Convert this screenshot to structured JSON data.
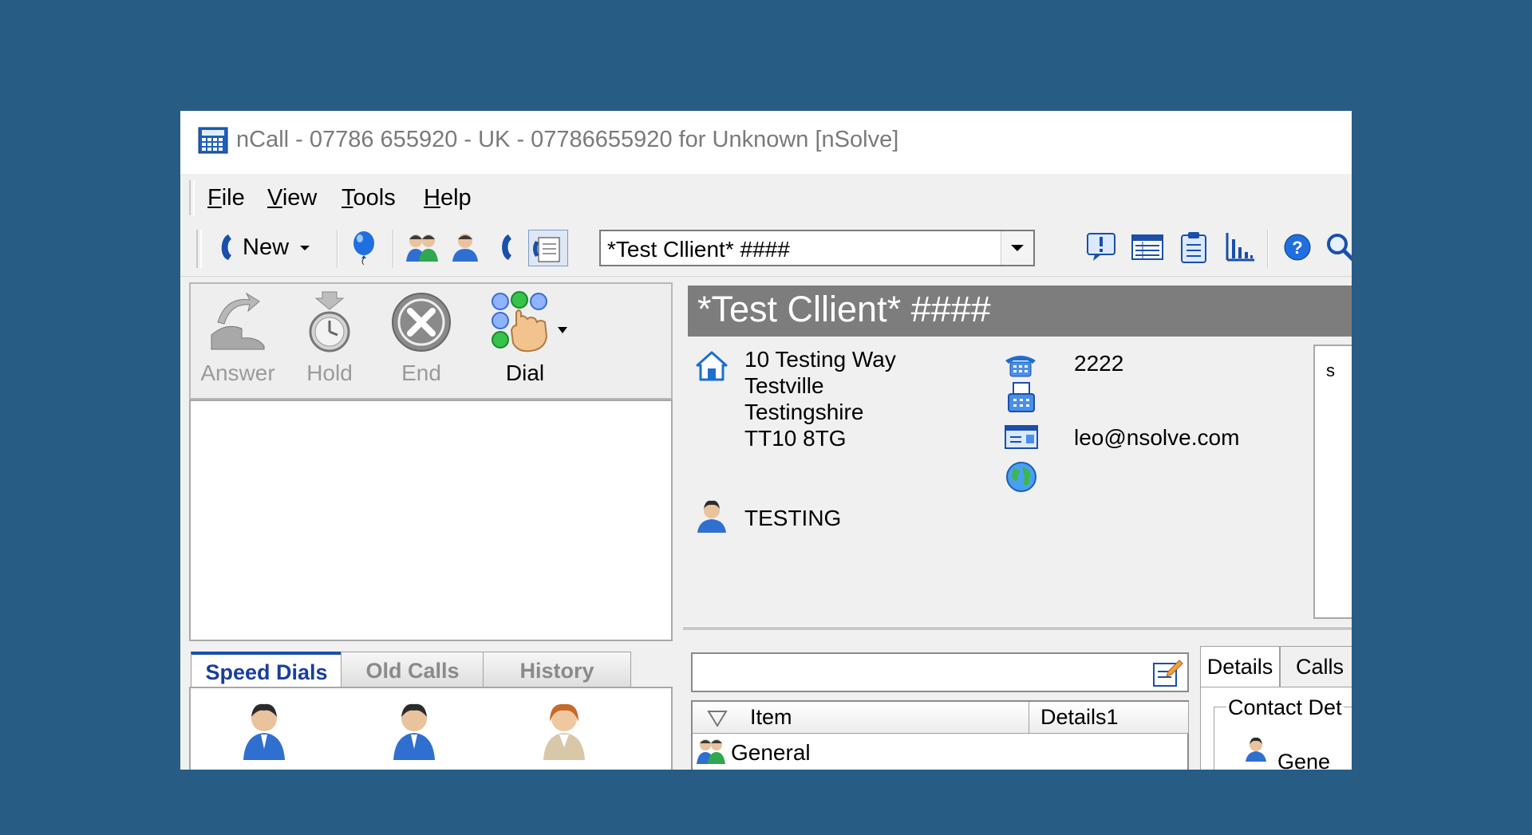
{
  "window": {
    "title": "nCall - 07786 655920 - UK - 07786655920 for Unknown [nSolve]"
  },
  "menu": {
    "items": [
      {
        "key": "F",
        "rest": "ile"
      },
      {
        "key": "V",
        "rest": "iew"
      },
      {
        "key": "T",
        "rest": "ools"
      },
      {
        "key": "H",
        "rest": "elp"
      }
    ]
  },
  "toolbar": {
    "new_label": "New",
    "client_combo_value": "*Test Cllient* ####"
  },
  "call_controls": {
    "answer_label": "Answer",
    "hold_label": "Hold",
    "end_label": "End",
    "dial_label": "Dial"
  },
  "left_tabs": {
    "speed_dials": "Speed Dials",
    "old_calls": "Old Calls",
    "history": "History"
  },
  "client": {
    "title": "*Test Cllient* ####",
    "address": [
      "10 Testing Way",
      "Testville",
      "Testingshire",
      "TT10 8TG"
    ],
    "phone": "2222",
    "email": "leo@nsolve.com",
    "contact": "TESTING",
    "notes_text": "s"
  },
  "grid": {
    "columns": [
      "Item",
      "Details1"
    ],
    "rows": [
      {
        "item": "General"
      }
    ]
  },
  "details_tabs": {
    "details": "Details",
    "calls": "Calls"
  },
  "details_panel": {
    "group_title": "Contact Det",
    "general_label": "Gene"
  },
  "colors": {
    "background": "#275c85",
    "header_gray": "#7d7d7d",
    "active_tab_blue": "#1a4faa"
  }
}
